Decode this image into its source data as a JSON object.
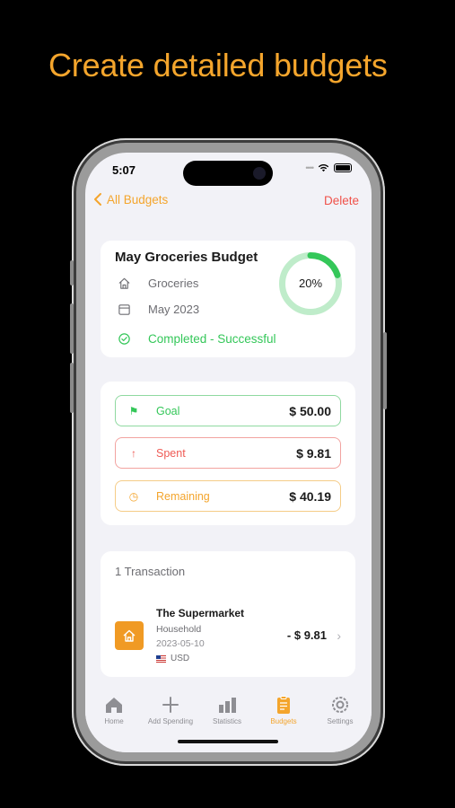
{
  "headline": "Create detailed budgets",
  "status_bar": {
    "time": "5:07"
  },
  "nav": {
    "back_label": "All Budgets",
    "delete_label": "Delete"
  },
  "budget": {
    "title": "May Groceries Budget",
    "category": "Groceries",
    "period": "May 2023",
    "status": "Completed - Successful",
    "progress_label": "20%",
    "progress": 0.2
  },
  "amounts": {
    "goal": {
      "label": "Goal",
      "value": "$ 50.00"
    },
    "spent": {
      "label": "Spent",
      "value": "$ 9.81"
    },
    "remaining": {
      "label": "Remaining",
      "value": "$ 40.19"
    }
  },
  "transactions": {
    "count_label": "1 Transaction",
    "items": [
      {
        "merchant": "The Supermarket",
        "category": "Household",
        "date": "2023-05-10",
        "currency": "USD",
        "amount": "- $ 9.81"
      }
    ]
  },
  "tabs": [
    {
      "label": "Home",
      "icon": "home-icon"
    },
    {
      "label": "Add Spending",
      "icon": "plus-icon"
    },
    {
      "label": "Statistics",
      "icon": "bar-chart-icon"
    },
    {
      "label": "Budgets",
      "icon": "clipboard-icon"
    },
    {
      "label": "Settings",
      "icon": "gear-icon"
    }
  ],
  "colors": {
    "accent": "#f4a52c",
    "success": "#34c759",
    "danger": "#ef5b55",
    "background": "#f2f2f7"
  },
  "active_tab": "Budgets"
}
